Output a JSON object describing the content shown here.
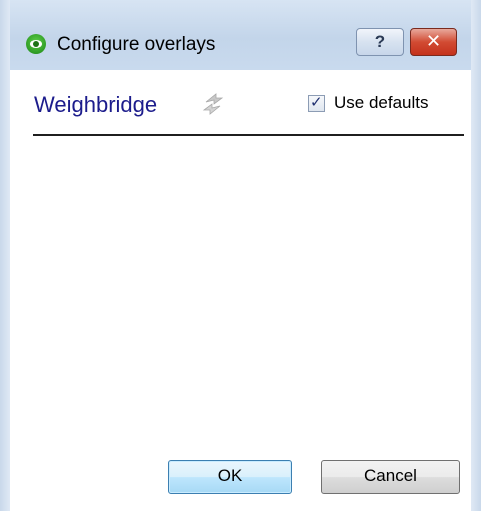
{
  "window": {
    "title": "Configure overlays",
    "help_glyph": "?",
    "close_glyph": "✕",
    "app_icon": "eye-icon"
  },
  "section": {
    "title": "Weighbridge",
    "refresh_icon": "refresh-arrows-icon"
  },
  "use_defaults": {
    "label": "Use defaults",
    "checked": true,
    "check_glyph": "✓"
  },
  "buttons": {
    "ok_label": "OK",
    "cancel_label": "Cancel"
  },
  "colors": {
    "section_title": "#1c1c8c",
    "titlebar": "#c3d5ea",
    "close_button": "#c4321c",
    "ok_button": "#bee6fd"
  }
}
